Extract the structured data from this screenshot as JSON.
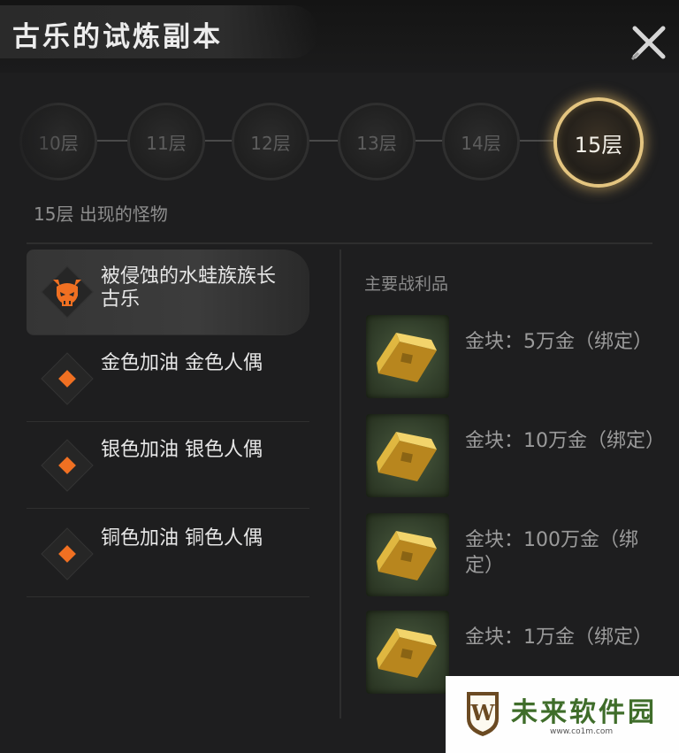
{
  "header": {
    "title": "古乐的试炼副本",
    "close_icon": "close-x-icon"
  },
  "floors": {
    "items": [
      {
        "label": "10层",
        "active": false
      },
      {
        "label": "11层",
        "active": false
      },
      {
        "label": "12层",
        "active": false
      },
      {
        "label": "13层",
        "active": false
      },
      {
        "label": "14层",
        "active": false
      },
      {
        "label": "15层",
        "active": true
      }
    ],
    "caption": "15层 出现的怪物"
  },
  "monsters": [
    {
      "name": "被侵蚀的水蛙族族长 古乐",
      "icon": "demon-skull-icon",
      "selected": true
    },
    {
      "name": "金色加油 金色人偶",
      "icon": "orange-diamond-icon",
      "selected": false
    },
    {
      "name": "银色加油 银色人偶",
      "icon": "orange-diamond-icon",
      "selected": false
    },
    {
      "name": "铜色加油 铜色人偶",
      "icon": "orange-diamond-icon",
      "selected": false
    }
  ],
  "loot": {
    "title": "主要战利品",
    "items": [
      {
        "text": "金块：5万金（绑定）",
        "icon": "gold-bar-icon"
      },
      {
        "text": "金块：10万金（绑定）",
        "icon": "gold-bar-icon"
      },
      {
        "text": "金块：100万金（绑定）",
        "icon": "gold-bar-icon"
      },
      {
        "text": "金块：1万金（绑定）",
        "icon": "gold-bar-icon"
      }
    ]
  },
  "watermark": {
    "name": "未来软件园",
    "url": "www.co1m.com",
    "logo_letter": "W"
  },
  "colors": {
    "accent_gold": "#e4c580",
    "monster_orange": "#f07022",
    "watermark_green": "#3f6d2a"
  }
}
